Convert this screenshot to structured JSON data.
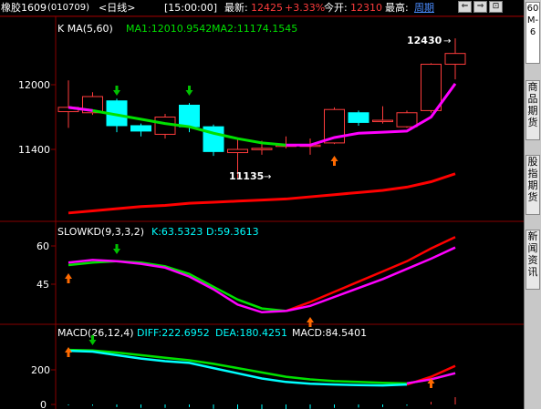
{
  "header": {
    "instrument": "橡胶1609",
    "code": "(010709)",
    "period_tag": "<日线>",
    "time": "[15:00:00]",
    "latest_label": "最新:",
    "latest_value": "12425",
    "change": "+3.33%",
    "open_label": "今开:",
    "open_value": "12310",
    "high_label": "最高:",
    "high_value": "周期",
    "nav_buttons": [
      "⇐",
      "⇒",
      "⊡"
    ]
  },
  "sidebar": {
    "period_tab": "60M-6",
    "tabs": [
      "商品期货",
      "股指期货",
      "新闻资讯"
    ]
  },
  "colors": {
    "up": "#ff3c3c",
    "down": "#00ffff",
    "ma1": "#00e000",
    "ma2": "#ff00ff",
    "ma_long": "#ff0000",
    "grid": "#880000",
    "axis_text": "#ffffff",
    "annotation": "#ffffff"
  },
  "main_panel": {
    "title": "K  MA(5,60)",
    "ma1_label": "MA1:12010.9542",
    "ma2_label": "MA2:11174.1545",
    "y_ticks": [
      "12000",
      "11400"
    ],
    "high_annotation": "12430",
    "low_annotation": "11135"
  },
  "kd_panel": {
    "title": "SLOWKD(9,3,3,2)",
    "k_label": "K:63.5323",
    "d_label": "D:59.3613",
    "y_ticks": [
      "60",
      "45"
    ]
  },
  "macd_panel": {
    "title": "MACD(26,12,4)",
    "diff_label": "DIFF:222.6952",
    "dea_label": "DEA:180.4251",
    "macd_label": "MACD:84.5401",
    "y_ticks": [
      "200",
      "0"
    ]
  },
  "chart_data": {
    "type": "candlestick",
    "candles": [
      {
        "o": 11750,
        "c": 11790,
        "h": 12040,
        "l": 11600
      },
      {
        "o": 11740,
        "c": 11890,
        "h": 11930,
        "l": 11720
      },
      {
        "o": 11850,
        "c": 11620,
        "h": 11870,
        "l": 11560
      },
      {
        "o": 11620,
        "c": 11570,
        "h": 11640,
        "l": 11520
      },
      {
        "o": 11540,
        "c": 11700,
        "h": 11730,
        "l": 11500
      },
      {
        "o": 11810,
        "c": 11610,
        "h": 11830,
        "l": 11560
      },
      {
        "o": 11610,
        "c": 11380,
        "h": 11630,
        "l": 11340
      },
      {
        "o": 11370,
        "c": 11400,
        "h": 11500,
        "l": 11135
      },
      {
        "o": 11400,
        "c": 11410,
        "h": 11480,
        "l": 11350
      },
      {
        "o": 11430,
        "c": 11440,
        "h": 11520,
        "l": 11410
      },
      {
        "o": 11430,
        "c": 11440,
        "h": 11500,
        "l": 11350
      },
      {
        "o": 11460,
        "c": 11770,
        "h": 11790,
        "l": 11450
      },
      {
        "o": 11740,
        "c": 11650,
        "h": 11760,
        "l": 11620
      },
      {
        "o": 11660,
        "c": 11670,
        "h": 11800,
        "l": 11640
      },
      {
        "o": 11610,
        "c": 11740,
        "h": 11760,
        "l": 11600
      },
      {
        "o": 11760,
        "c": 12190,
        "h": 12200,
        "l": 11740
      },
      {
        "o": 12190,
        "c": 12290,
        "h": 12430,
        "l": 12050
      }
    ],
    "ma1": [
      11790,
      11760,
      11720,
      11680,
      11640,
      11610,
      11550,
      11500,
      11460,
      11440,
      11440,
      11510,
      11550,
      11560,
      11570,
      11700,
      12010
    ],
    "ma2": [
      10810,
      10830,
      10850,
      10870,
      10880,
      10900,
      10910,
      10920,
      10930,
      10940,
      10960,
      10980,
      11000,
      11020,
      11050,
      11100,
      11174
    ],
    "slowkd": {
      "k": [
        53.5,
        54.5,
        54,
        53,
        51.5,
        48,
        43,
        37,
        34,
        34.5,
        38,
        42,
        46,
        50,
        54,
        59,
        63.5
      ],
      "d": [
        52.5,
        53.5,
        54,
        53.5,
        52,
        49,
        44,
        39,
        35.5,
        34.5,
        36.5,
        40,
        43.5,
        47,
        51,
        55,
        59.4
      ]
    },
    "macd": {
      "diff": [
        310,
        305,
        285,
        265,
        250,
        240,
        210,
        180,
        150,
        130,
        120,
        115,
        112,
        110,
        115,
        160,
        222.7
      ],
      "dea": [
        315,
        312,
        300,
        285,
        270,
        255,
        235,
        210,
        185,
        160,
        145,
        135,
        130,
        125,
        122,
        145,
        180.4
      ],
      "macd": [
        -5,
        -7,
        -15,
        -20,
        -20,
        -15,
        -25,
        -30,
        -35,
        -30,
        -25,
        -20,
        -18,
        -15,
        -7,
        15,
        42,
        84.5
      ]
    }
  }
}
